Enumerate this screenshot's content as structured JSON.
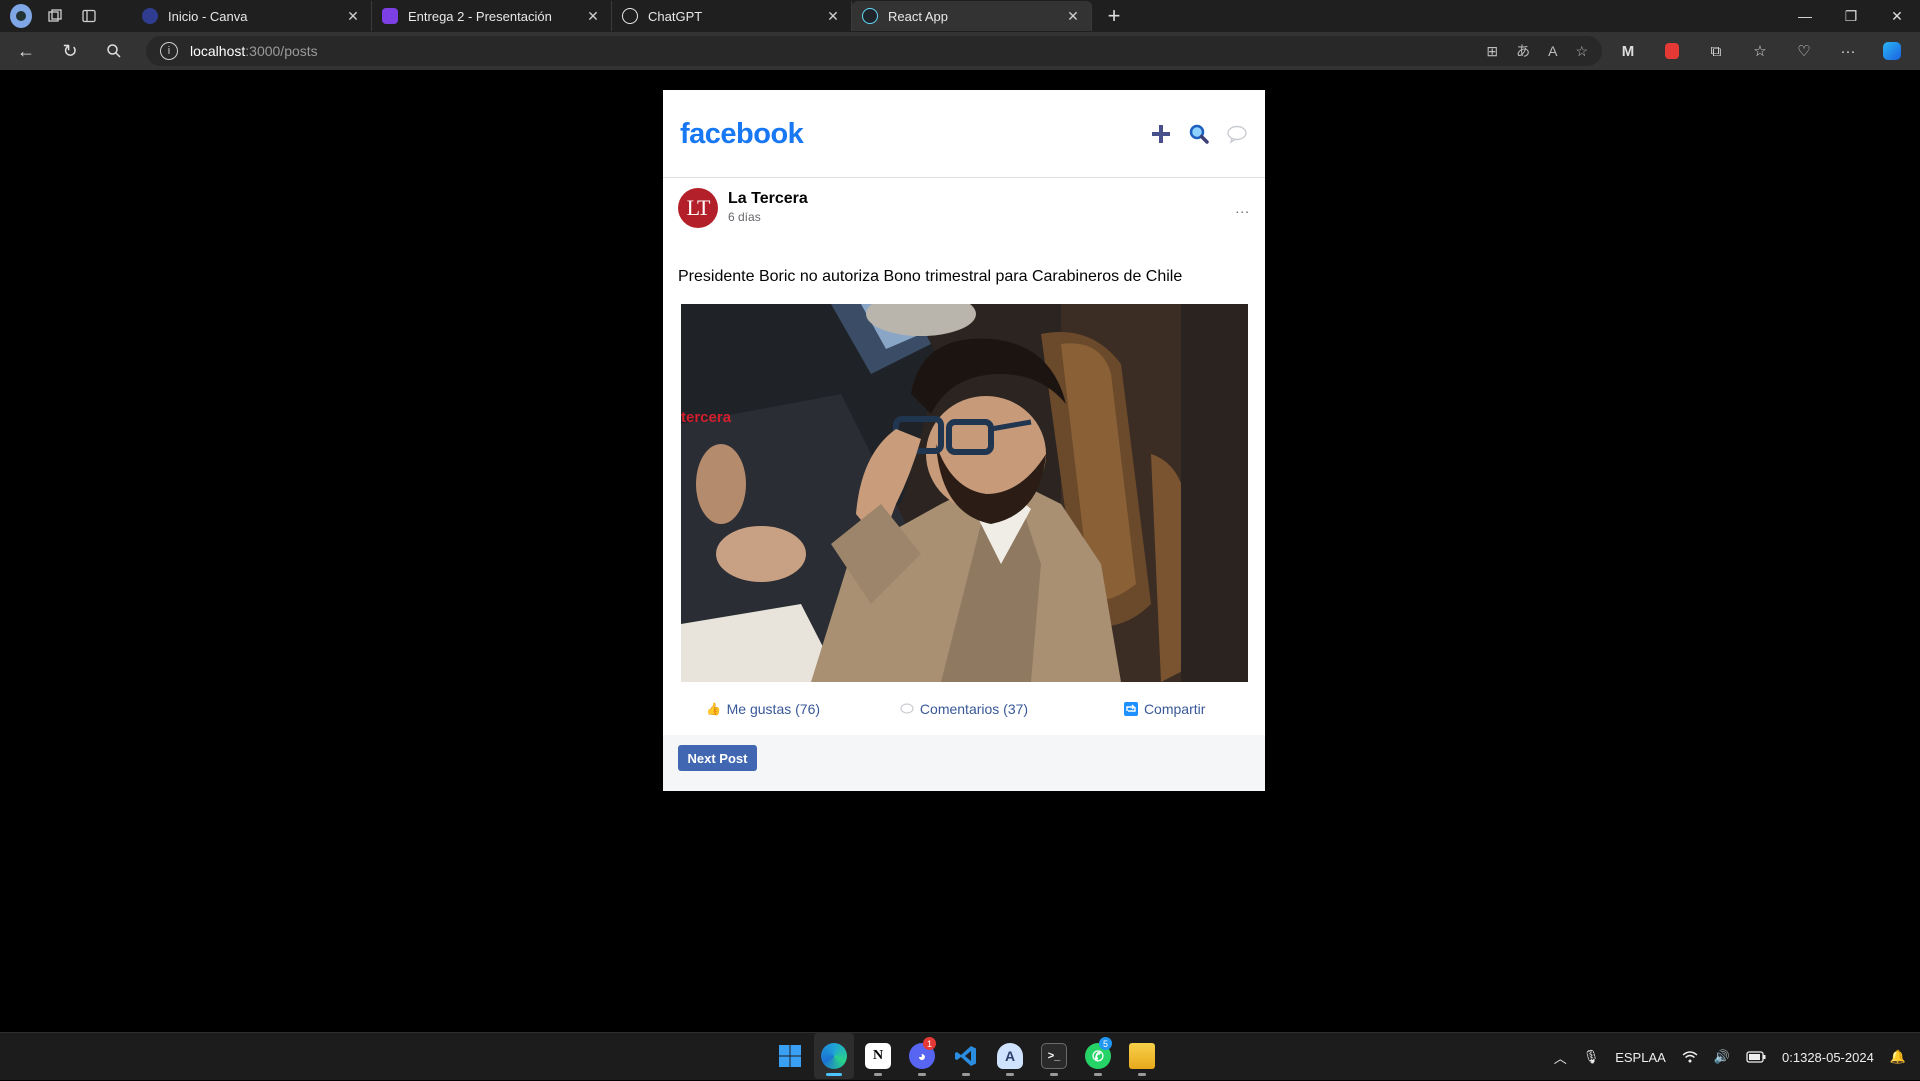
{
  "browser": {
    "tabs": [
      {
        "title": "Inicio - Canva",
        "favicon": "canva-icon",
        "favicon_color": "#2f3c8f",
        "active": false
      },
      {
        "title": "Entrega 2 - Presentación",
        "favicon": "canva-doc-icon",
        "favicon_color": "#7b3fe4",
        "active": false
      },
      {
        "title": "ChatGPT",
        "favicon": "chatgpt-icon",
        "favicon_color": "#e8e8e8",
        "active": false
      },
      {
        "title": "React App",
        "favicon": "react-icon",
        "favicon_color": "#61dafb",
        "active": true
      }
    ],
    "url_host": "localhost",
    "url_path": ":3000/posts"
  },
  "page": {
    "logo": "facebook",
    "colors": {
      "brand": "#1877f2",
      "link": "#385898",
      "button": "#4267b2"
    },
    "post": {
      "author": "La Tercera",
      "avatar_initials": "LT",
      "time": "6 días",
      "more": "...",
      "text": "Presidente Boric no autoriza Bono trimestral para Carabineros de Chile",
      "image_watermark": "tercera",
      "actions": {
        "like": "Me gustas (76)",
        "comment": "Comentarios (37)",
        "share": "Compartir"
      }
    },
    "next_button": "Next Post"
  },
  "taskbar": {
    "apps": [
      {
        "name": "windows-start-icon",
        "color": "#2f8ef0"
      },
      {
        "name": "edge-icon",
        "color": "#1fa2d8",
        "active": true
      },
      {
        "name": "notion-icon",
        "color": "#ffffff"
      },
      {
        "name": "discord-icon",
        "color": "#5865f2",
        "badge": "1",
        "badge_color": "#e53935"
      },
      {
        "name": "vscode-icon",
        "color": "#2a8ddf"
      },
      {
        "name": "app-icon",
        "color": "#8ab4f8"
      },
      {
        "name": "terminal-icon",
        "color": "#3a3a3a"
      },
      {
        "name": "whatsapp-icon",
        "color": "#25d366",
        "badge": "5",
        "badge_color": "#2196f3"
      },
      {
        "name": "file-explorer-icon",
        "color": "#f4c430"
      }
    ],
    "language": "ESP",
    "keyboard": "LAA",
    "time": "0:13",
    "date": "28-05-2024"
  }
}
